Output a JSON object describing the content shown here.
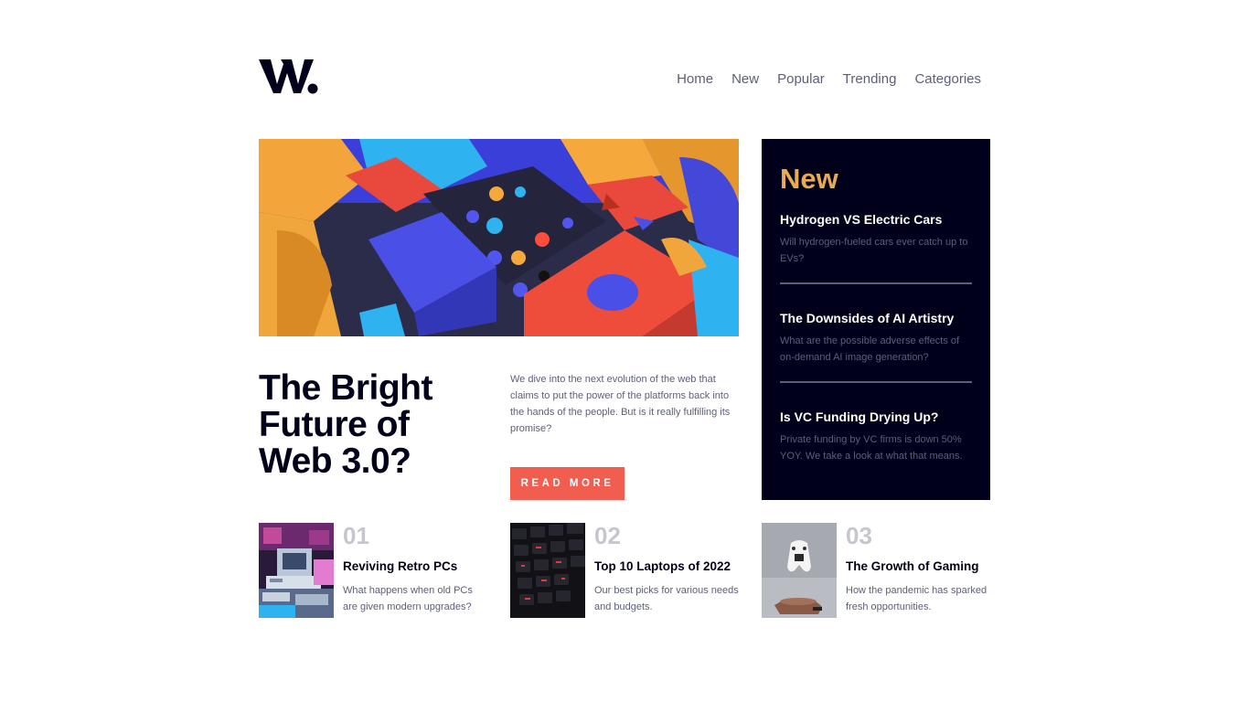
{
  "header": {
    "logo_alt": "W.",
    "nav": [
      "Home",
      "New",
      "Popular",
      "Trending",
      "Categories"
    ]
  },
  "hero": {
    "image_icon": "abstract-3d-blocks-image",
    "headline": "The Bright Future of Web 3.0?",
    "lede": "We dive into the next evolution of the web that claims to put the power of the platforms back into the hands of the people. But is it really fulfilling its promise?",
    "button_label": "READ MORE"
  },
  "new_panel": {
    "title": "New",
    "items": [
      {
        "title": "Hydrogen VS Electric Cars",
        "desc": "Will hydrogen-fueled cars ever catch up to EVs?"
      },
      {
        "title": "The Downsides of AI Artistry",
        "desc": "What are the possible adverse effects of on-demand AI image generation?"
      },
      {
        "title": "Is VC Funding Drying Up?",
        "desc": "Private funding by VC firms is down 50% YOY. We take a look at what that means."
      }
    ]
  },
  "cards": [
    {
      "num": "01",
      "title": "Reviving Retro PCs",
      "desc": "What happens when old PCs are given modern upgrades?",
      "image_icon": "retro-pc-image"
    },
    {
      "num": "02",
      "title": "Top 10 Laptops of 2022",
      "desc": "Our best picks for various needs and budgets.",
      "image_icon": "keyboard-image"
    },
    {
      "num": "03",
      "title": "The Growth of Gaming",
      "desc": "How the pandemic has sparked fresh opportunities.",
      "image_icon": "game-controller-image"
    }
  ],
  "colors": {
    "dark_navy": "#00001a",
    "soft_orange": "#e9ab53",
    "soft_red": "#f15e50",
    "grayish_blue": "#5d5f79",
    "light_gray": "#c5c6ce"
  }
}
